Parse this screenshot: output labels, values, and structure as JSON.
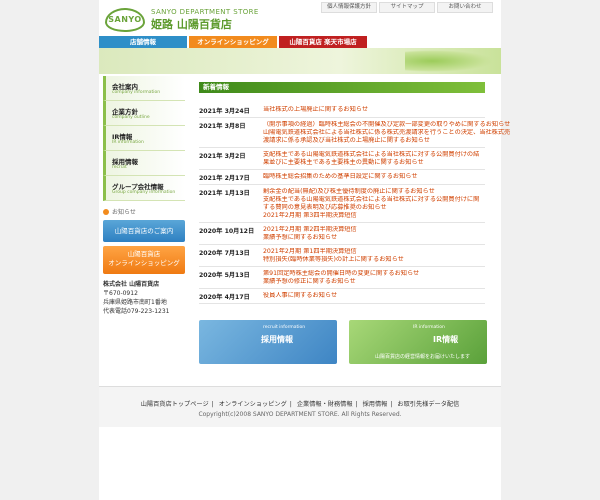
{
  "header": {
    "logo_text": "SANYO",
    "brand_en": "SANYO DEPARTMENT STORE",
    "brand_ja": "姫路 山陽百貨店",
    "utility": [
      "個人情報保護方針",
      "サイトマップ",
      "お問い合わせ"
    ]
  },
  "tabs": [
    "店舗情報",
    "オンラインショッピング",
    "山陽百貨店 楽天市場店"
  ],
  "sidebar": {
    "items": [
      {
        "title": "会社案内",
        "sub": "company information"
      },
      {
        "title": "企業方針",
        "sub": "company outline"
      },
      {
        "title": "IR情報",
        "sub": "IR information"
      },
      {
        "title": "採用情報",
        "sub": "recruit"
      },
      {
        "title": "グループ会社情報",
        "sub": "Group company information"
      }
    ],
    "notice": "お知らせ",
    "store_button": "山陽百貨店のご案内",
    "online_button_1": "山陽百貨店",
    "online_button_2": "オンラインショッピング",
    "company": {
      "name": "株式会社 山陽百貨店",
      "zip": "〒670-0912",
      "address": "兵庫県姫路市南町1番地",
      "tel": "代表電話079-223-1231"
    }
  },
  "news": {
    "title": "新着情報",
    "items": [
      {
        "date": "2021年 3月24日",
        "links": [
          "当社株式の上場廃止に関するお知らせ"
        ]
      },
      {
        "date": "2021年 3月8日",
        "links": [
          "（開示事項の経過）臨時株主総会の不開催及び定款一部変更の取りやめに関するお知らせ",
          "山陽電気鉄道株式会社による当社株式に係る株式売渡請求を行うことの決定、当社株式売渡請求に係る承認及び当社株式の上場廃止に関するお知らせ"
        ]
      },
      {
        "date": "2021年 3月2日",
        "links": [
          "支配株主である山陽電気鉄道株式会社による当社株式に対する公開買付けの結果並びに主要株主である主要株主の異動に関するお知らせ"
        ]
      },
      {
        "date": "2021年 2月17日",
        "links": [
          "臨時株主総会招集のための基準日設定に関するお知らせ"
        ]
      },
      {
        "date": "2021年 1月13日",
        "links": [
          "剰余金の配当(無配)及び株主優待制度の廃止に関するお知らせ",
          "支配株主である山陽電気鉄道株式会社による当社株式に対する公開買付けに関する賛同の意見表明及び応募推奨のお知らせ",
          "2021年2月期 第3四半期決算短信"
        ]
      },
      {
        "date": "2020年 10月12日",
        "links": [
          "2021年2月期 第2四半期決算短信",
          "業績予想に関するお知らせ"
        ]
      },
      {
        "date": "2020年 7月13日",
        "links": [
          "2021年2月期 第1四半期決算短信",
          "特別損失(臨時休業等損失)の計上に関するお知らせ"
        ]
      },
      {
        "date": "2020年 5月13日",
        "links": [
          "第91回定時株主総会の開催日時の変更に関するお知らせ",
          "業績予想の修正に関するお知らせ"
        ]
      },
      {
        "date": "2020年 4月17日",
        "links": [
          "役員人事に関するお知らせ"
        ]
      }
    ]
  },
  "banners": {
    "recruit_en": "recruit information",
    "recruit_ja": "採用情報",
    "ir_en": "IR information",
    "ir_ja": "IR情報",
    "ir_extra": "山陽百貨店の経営情報をお届けいたします"
  },
  "footer": {
    "links": [
      "山陽百貨店トップページ",
      "オンラインショッピング",
      "企業情報・財務情報",
      "採用情報",
      "お取引先様データ配信"
    ],
    "copyright": "Copyright(c)2008 SANYO DEPARTMENT STORE. All Rights Reserved."
  }
}
